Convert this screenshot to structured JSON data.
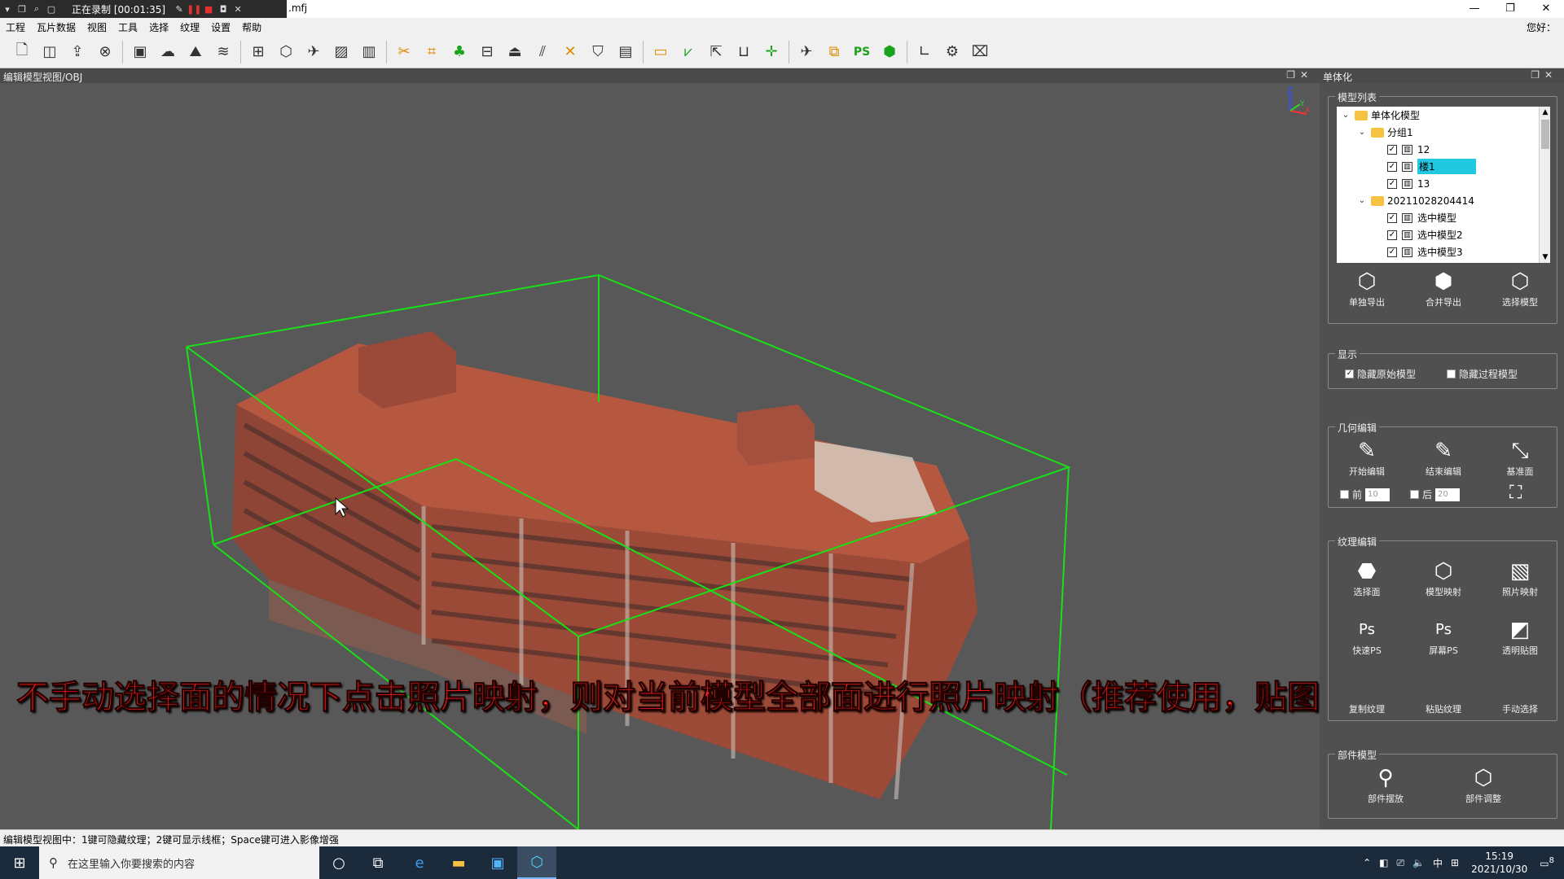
{
  "titlebar": {
    "recording": "正在录制 [00:01:35]",
    "filename": ".mfj",
    "controls": [
      "—",
      "❐",
      "✕"
    ]
  },
  "menu": {
    "items": [
      "工程",
      "瓦片数据",
      "视图",
      "工具",
      "选择",
      "纹理",
      "设置",
      "帮助"
    ],
    "hello": "您好："
  },
  "viewport": {
    "title": "编辑模型视图/OBJ",
    "caption": "不手动选择面的情况下点击照片映射，则对当前模型全部面进行照片映射（推荐使用，贴图效果更佳）"
  },
  "panel": {
    "title": "单体化",
    "model_list": {
      "title": "模型列表",
      "tree": [
        {
          "level": 0,
          "type": "folder",
          "label": "单体化模型",
          "expanded": true
        },
        {
          "level": 1,
          "type": "folder",
          "label": "分组1",
          "expanded": true
        },
        {
          "level": 2,
          "type": "item",
          "label": "12",
          "checked": true
        },
        {
          "level": 2,
          "type": "item",
          "label": "楼1",
          "checked": true,
          "selected": true
        },
        {
          "level": 2,
          "type": "item",
          "label": "13",
          "checked": true
        },
        {
          "level": 1,
          "type": "folder",
          "label": "20211028204414",
          "expanded": true
        },
        {
          "level": 2,
          "type": "item",
          "label": "选中模型",
          "checked": true
        },
        {
          "level": 2,
          "type": "item",
          "label": "选中模型2",
          "checked": true
        },
        {
          "level": 2,
          "type": "item",
          "label": "选中模型3",
          "checked": true
        }
      ],
      "buttons": [
        "单独导出",
        "合并导出",
        "选择模型"
      ]
    },
    "display": {
      "title": "显示",
      "hide_original": "隐藏原始模型",
      "hide_original_checked": true,
      "hide_process": "隐藏过程模型",
      "hide_process_checked": false
    },
    "geometry": {
      "title": "几何编辑",
      "buttons": [
        "开始编辑",
        "结束编辑",
        "基准面"
      ],
      "front_label": "前",
      "front_value": "10",
      "back_label": "后",
      "back_value": "20"
    },
    "texture": {
      "title": "纹理编辑",
      "row1": [
        "选择面",
        "模型映射",
        "照片映射"
      ],
      "row2": [
        "快速PS",
        "屏幕PS",
        "透明贴图"
      ],
      "row3": [
        "复制纹理",
        "粘贴纹理",
        "手动选择"
      ]
    },
    "parts": {
      "title": "部件模型",
      "buttons": [
        "部件摆放",
        "部件调整"
      ]
    }
  },
  "statusbar": {
    "text": "编辑模型视图中：1键可隐藏纹理；2键可显示线框；Space键可进入影像增强"
  },
  "taskbar": {
    "search_placeholder": "在这里输入你要搜索的内容",
    "ime": "中",
    "time": "15:19",
    "date": "2021/10/30",
    "notifications": "8"
  }
}
